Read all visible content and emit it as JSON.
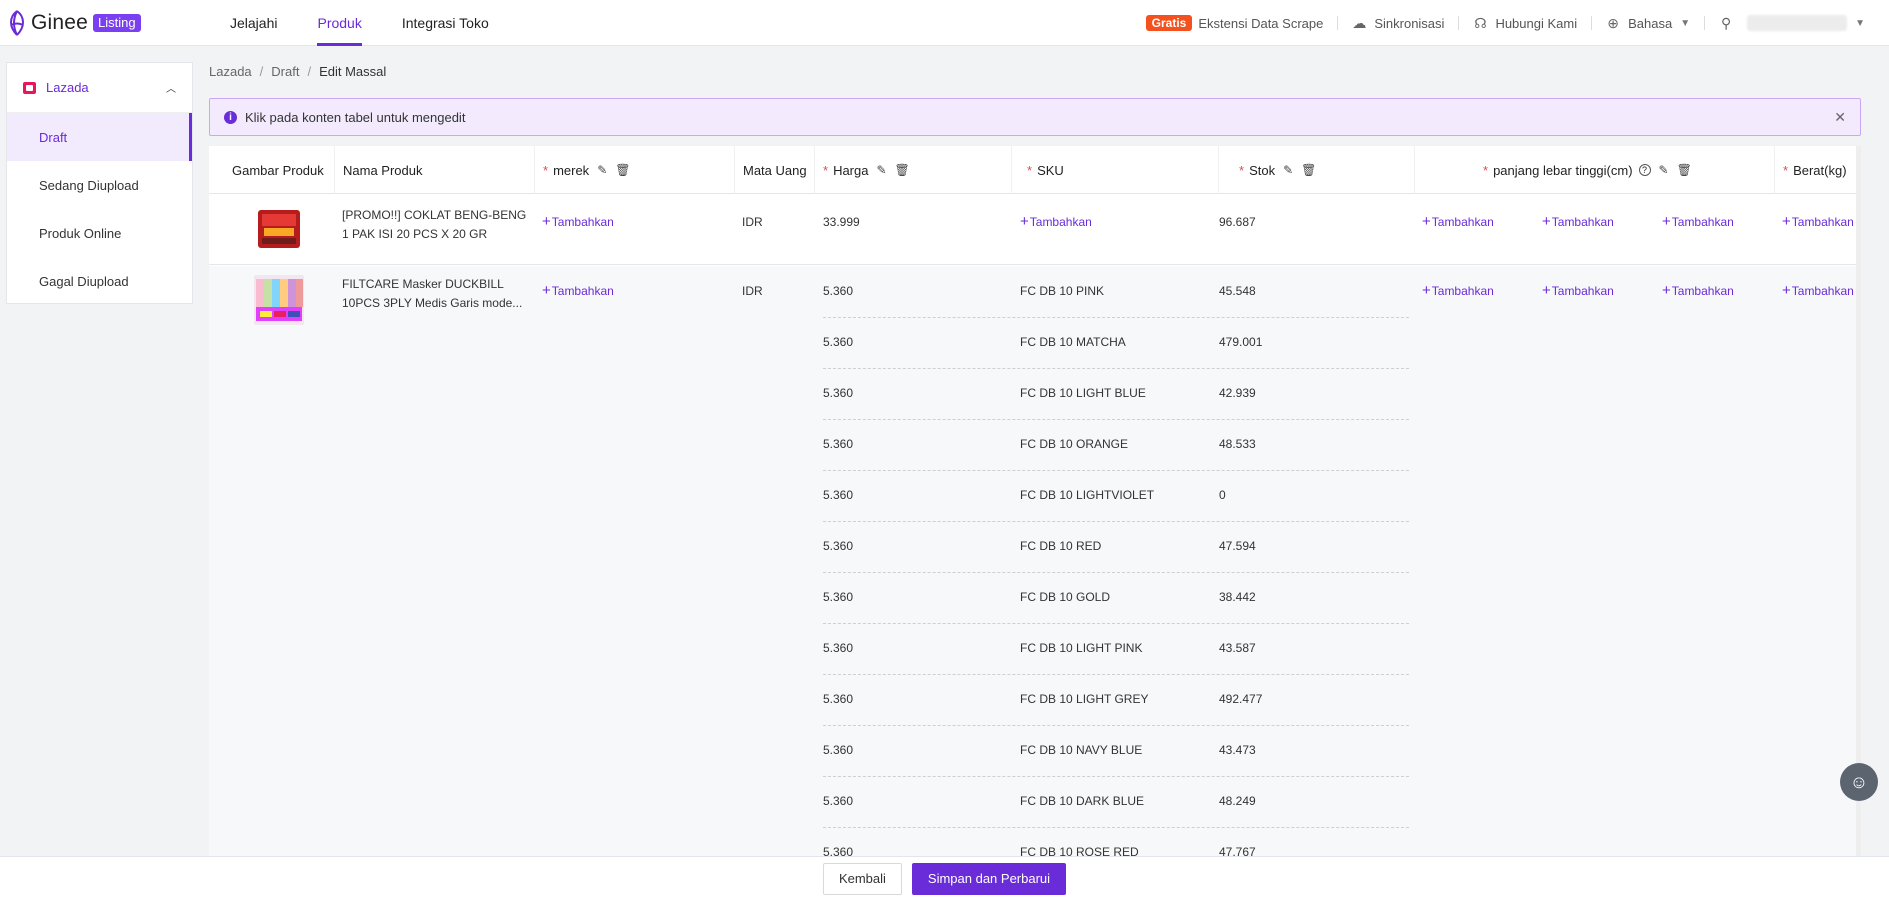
{
  "app": {
    "brand": "Ginee",
    "badge": "Listing"
  },
  "nav": [
    {
      "label": "Jelajahi"
    },
    {
      "label": "Produk"
    },
    {
      "label": "Integrasi Toko"
    }
  ],
  "topbar": {
    "gratis": "Gratis",
    "scrape": "Ekstensi Data Scrape",
    "sync": "Sinkronisasi",
    "contact": "Hubungi Kami",
    "language": "Bahasa"
  },
  "sidebar": {
    "channel": "Lazada",
    "items": [
      {
        "label": "Draft"
      },
      {
        "label": "Sedang Diupload"
      },
      {
        "label": "Produk Online"
      },
      {
        "label": "Gagal Diupload"
      }
    ]
  },
  "breadcrumb": [
    "Lazada",
    "Draft",
    "Edit Massal"
  ],
  "alert": {
    "text": "Klik pada konten tabel untuk mengedit"
  },
  "table": {
    "headers": {
      "image": "Gambar Produk",
      "name": "Nama Produk",
      "brand": "merek",
      "currency": "Mata Uang",
      "price": "Harga",
      "sku": "SKU",
      "stock": "Stok",
      "dimensions": "panjang lebar tinggi(cm)",
      "weight": "Berat(kg)"
    },
    "add_label": "Tambahkan",
    "products": [
      {
        "name": "[PROMO!!] COKLAT BENG-BENG 1 PAK ISI 20 PCS X 20 GR",
        "currency": "IDR",
        "variants": [
          {
            "price": "33.999",
            "sku": "",
            "stock": "96.687"
          }
        ]
      },
      {
        "name": "FILTCARE Masker DUCKBILL 10PCS 3PLY Medis Garis mode...",
        "currency": "IDR",
        "variants": [
          {
            "price": "5.360",
            "sku": "FC DB 10 PINK",
            "stock": "45.548"
          },
          {
            "price": "5.360",
            "sku": "FC DB 10 MATCHA",
            "stock": "479.001"
          },
          {
            "price": "5.360",
            "sku": "FC DB 10 LIGHT BLUE",
            "stock": "42.939"
          },
          {
            "price": "5.360",
            "sku": "FC DB 10 ORANGE",
            "stock": "48.533"
          },
          {
            "price": "5.360",
            "sku": "FC DB 10 LIGHTVIOLET",
            "stock": "0"
          },
          {
            "price": "5.360",
            "sku": "FC DB 10 RED",
            "stock": "47.594"
          },
          {
            "price": "5.360",
            "sku": "FC DB 10 GOLD",
            "stock": "38.442"
          },
          {
            "price": "5.360",
            "sku": "FC DB 10 LIGHT PINK",
            "stock": "43.587"
          },
          {
            "price": "5.360",
            "sku": "FC DB 10 LIGHT GREY",
            "stock": "492.477"
          },
          {
            "price": "5.360",
            "sku": "FC DB 10 NAVY BLUE",
            "stock": "43.473"
          },
          {
            "price": "5.360",
            "sku": "FC DB 10 DARK BLUE",
            "stock": "48.249"
          },
          {
            "price": "5.360",
            "sku": "FC DB 10 ROSE RED",
            "stock": "47.767"
          }
        ]
      }
    ]
  },
  "footer": {
    "back": "Kembali",
    "save": "Simpan dan Perbarui"
  },
  "colors": {
    "accent": "#6a2bd9",
    "gratis": "#f4511e",
    "required": "#e5484d"
  }
}
